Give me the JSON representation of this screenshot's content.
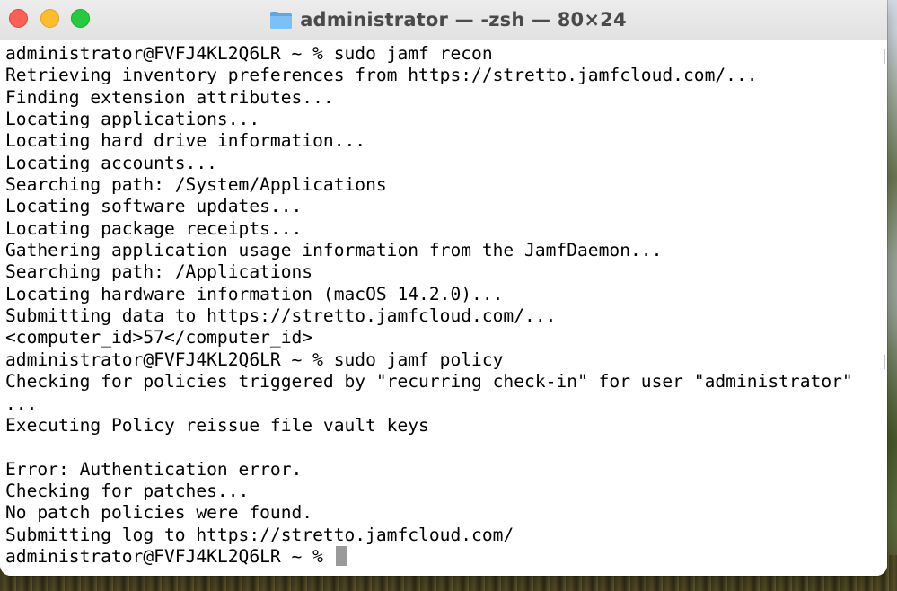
{
  "window": {
    "title": "administrator — -zsh — 80×24",
    "folder_icon": "folder-icon"
  },
  "traffic_lights": {
    "close_color": "#fe5f57",
    "minimize_color": "#febc2e",
    "zoom_color": "#28c840"
  },
  "terminal": {
    "lines": [
      "administrator@FVFJ4KL2Q6LR ~ % sudo jamf recon",
      "Retrieving inventory preferences from https://stretto.jamfcloud.com/...",
      "Finding extension attributes...",
      "Locating applications...",
      "Locating hard drive information...",
      "Locating accounts...",
      "Searching path: /System/Applications",
      "Locating software updates...",
      "Locating package receipts...",
      "Gathering application usage information from the JamfDaemon...",
      "Searching path: /Applications",
      "Locating hardware information (macOS 14.2.0)...",
      "Submitting data to https://stretto.jamfcloud.com/...",
      "<computer_id>57</computer_id>",
      "administrator@FVFJ4KL2Q6LR ~ % sudo jamf policy",
      "Checking for policies triggered by \"recurring check-in\" for user \"administrator\"",
      "...",
      "Executing Policy reissue file vault keys",
      "",
      "Error: Authentication error.",
      "Checking for patches...",
      "No patch policies were found.",
      "Submitting log to https://stretto.jamfcloud.com/",
      "administrator@FVFJ4KL2Q6LR ~ % "
    ],
    "prompt_mark_lines": [
      0,
      14
    ]
  }
}
